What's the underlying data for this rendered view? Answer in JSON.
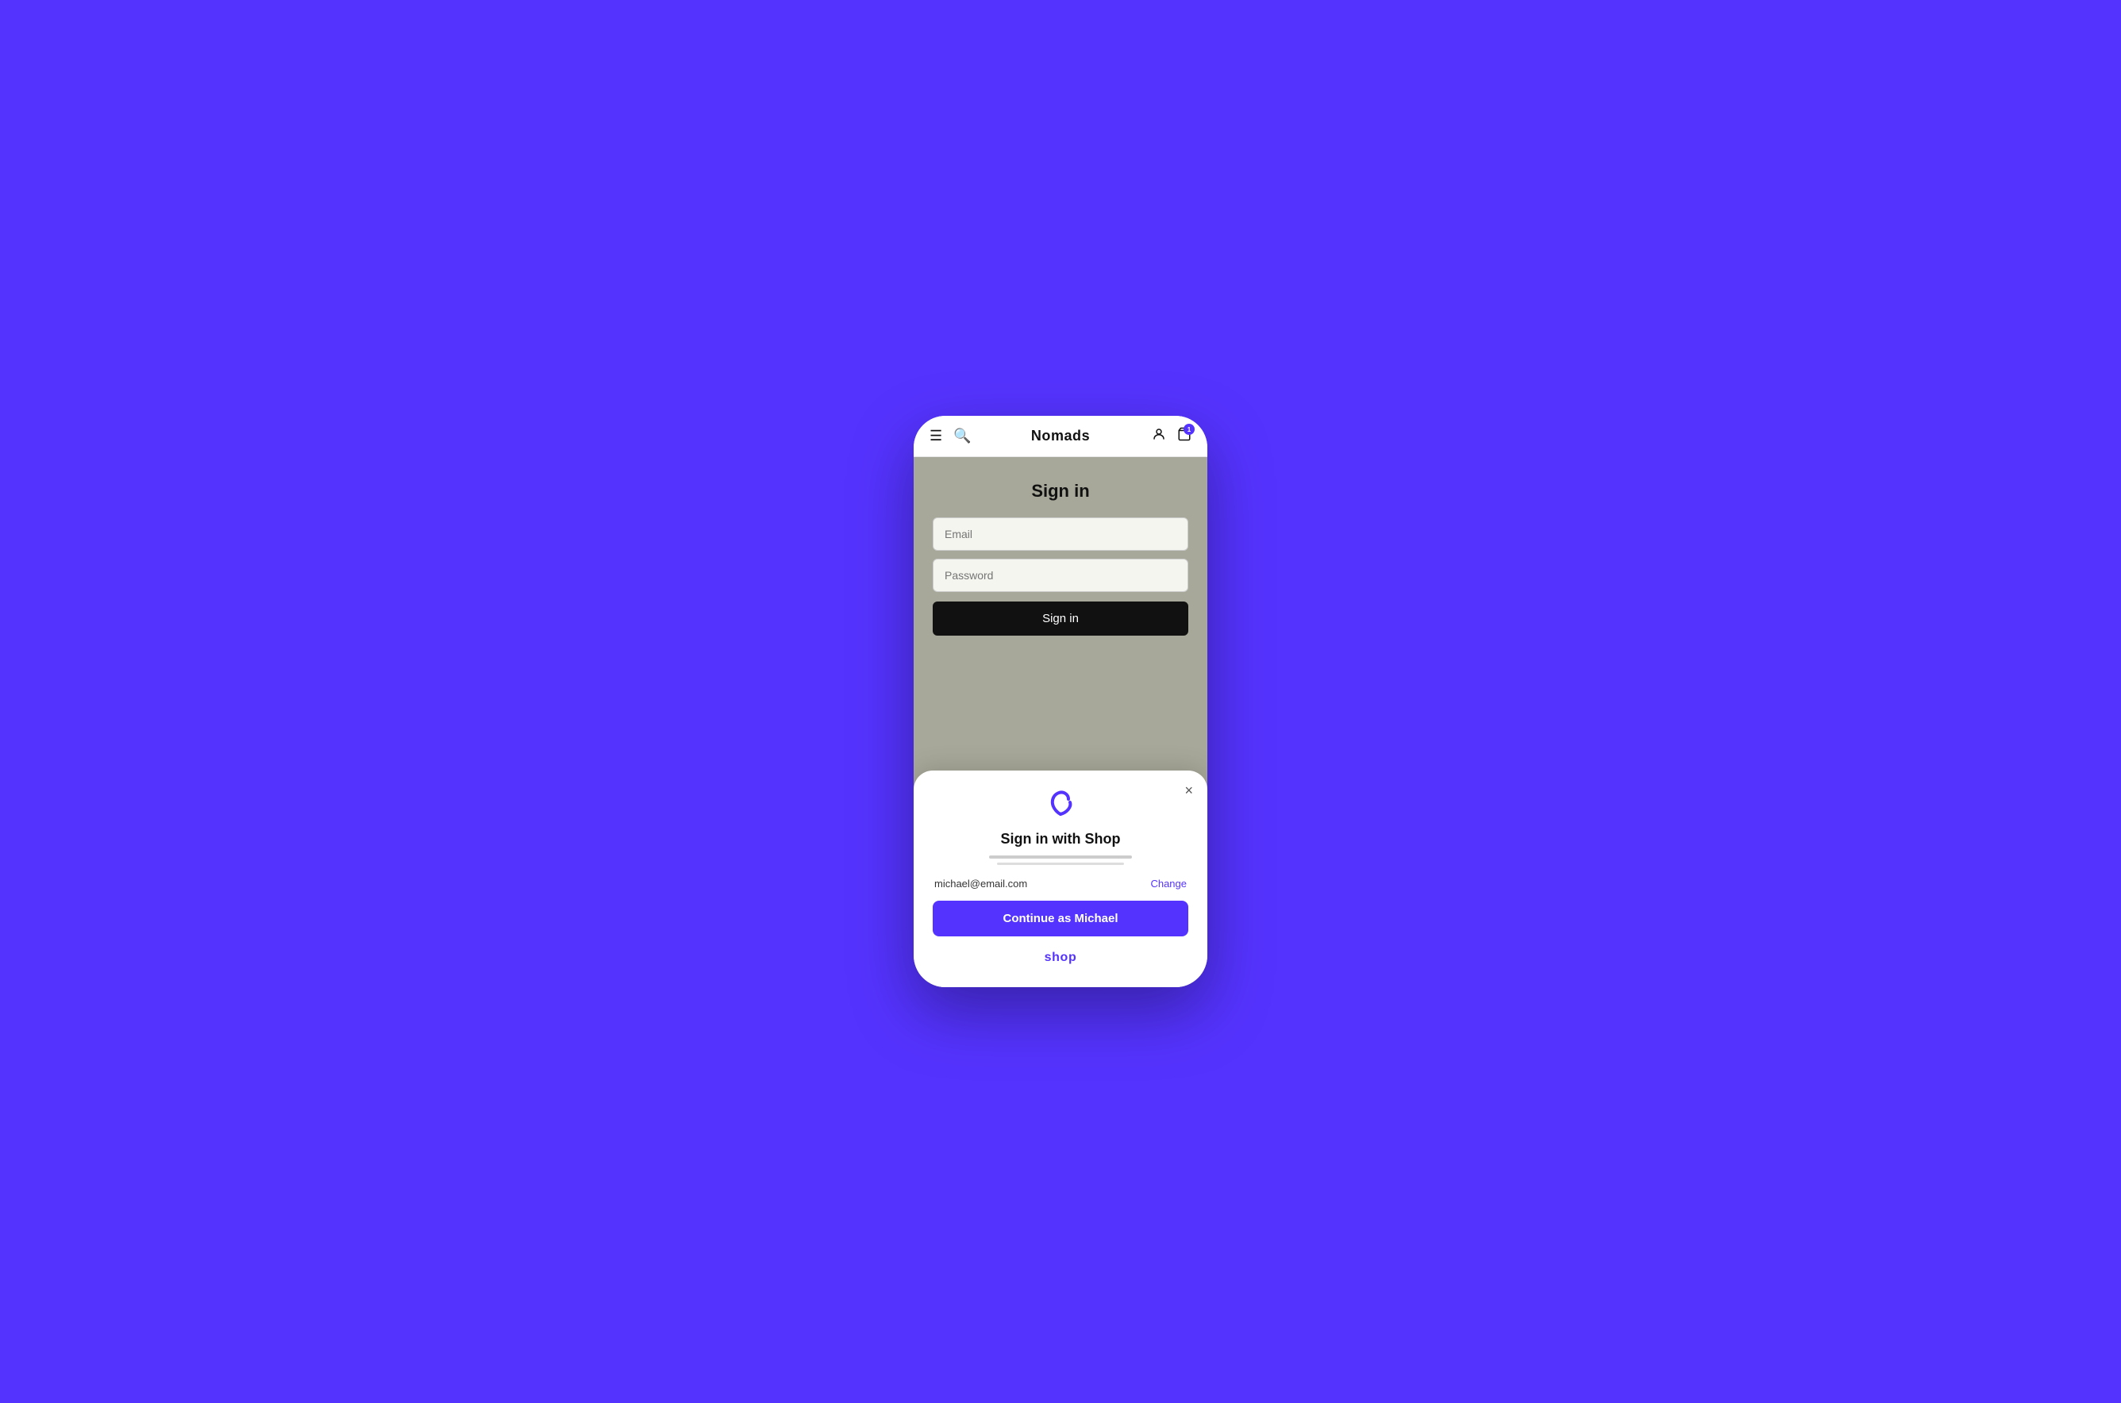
{
  "navbar": {
    "title": "Nomads",
    "cart_badge": "1"
  },
  "signin": {
    "title": "Sign in",
    "email_placeholder": "Email",
    "password_placeholder": "Password",
    "button_label": "Sign in"
  },
  "shop_modal": {
    "title": "Sign in with Shop",
    "email": "michael@email.com",
    "change_label": "Change",
    "continue_label": "Continue as Michael",
    "wordmark": "shop",
    "close_label": "×"
  }
}
